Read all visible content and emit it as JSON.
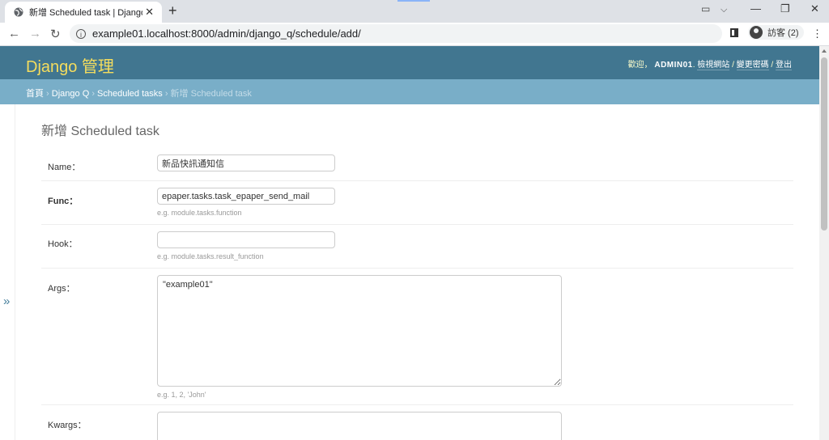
{
  "browser": {
    "tab_title": "新增 Scheduled task | Django 網",
    "url": "example01.localhost:8000/admin/django_q/schedule/add/",
    "profile_label": "訪客 (2)"
  },
  "header": {
    "brand": "Django 管理",
    "welcome": "歡迎，",
    "username": "ADMIN01",
    "view_site": "檢視網站",
    "change_password": "變更密碼",
    "logout": "登出"
  },
  "breadcrumbs": {
    "home": "首頁",
    "app": "Django Q",
    "model": "Scheduled tasks",
    "current": "新增 Scheduled task"
  },
  "content": {
    "title": "新增 Scheduled task"
  },
  "form": {
    "name": {
      "label": "Name：",
      "value": "新品快訊通知信"
    },
    "func": {
      "label": "Func：",
      "value": "epaper.tasks.task_epaper_send_mail",
      "help": "e.g. module.tasks.function"
    },
    "hook": {
      "label": "Hook：",
      "value": "",
      "help": "e.g. module.tasks.result_function"
    },
    "args": {
      "label": "Args：",
      "value": "\"example01\"",
      "help": "e.g. 1, 2, 'John'"
    },
    "kwargs": {
      "label": "Kwargs：",
      "value": ""
    }
  },
  "nav_toggle": "»"
}
